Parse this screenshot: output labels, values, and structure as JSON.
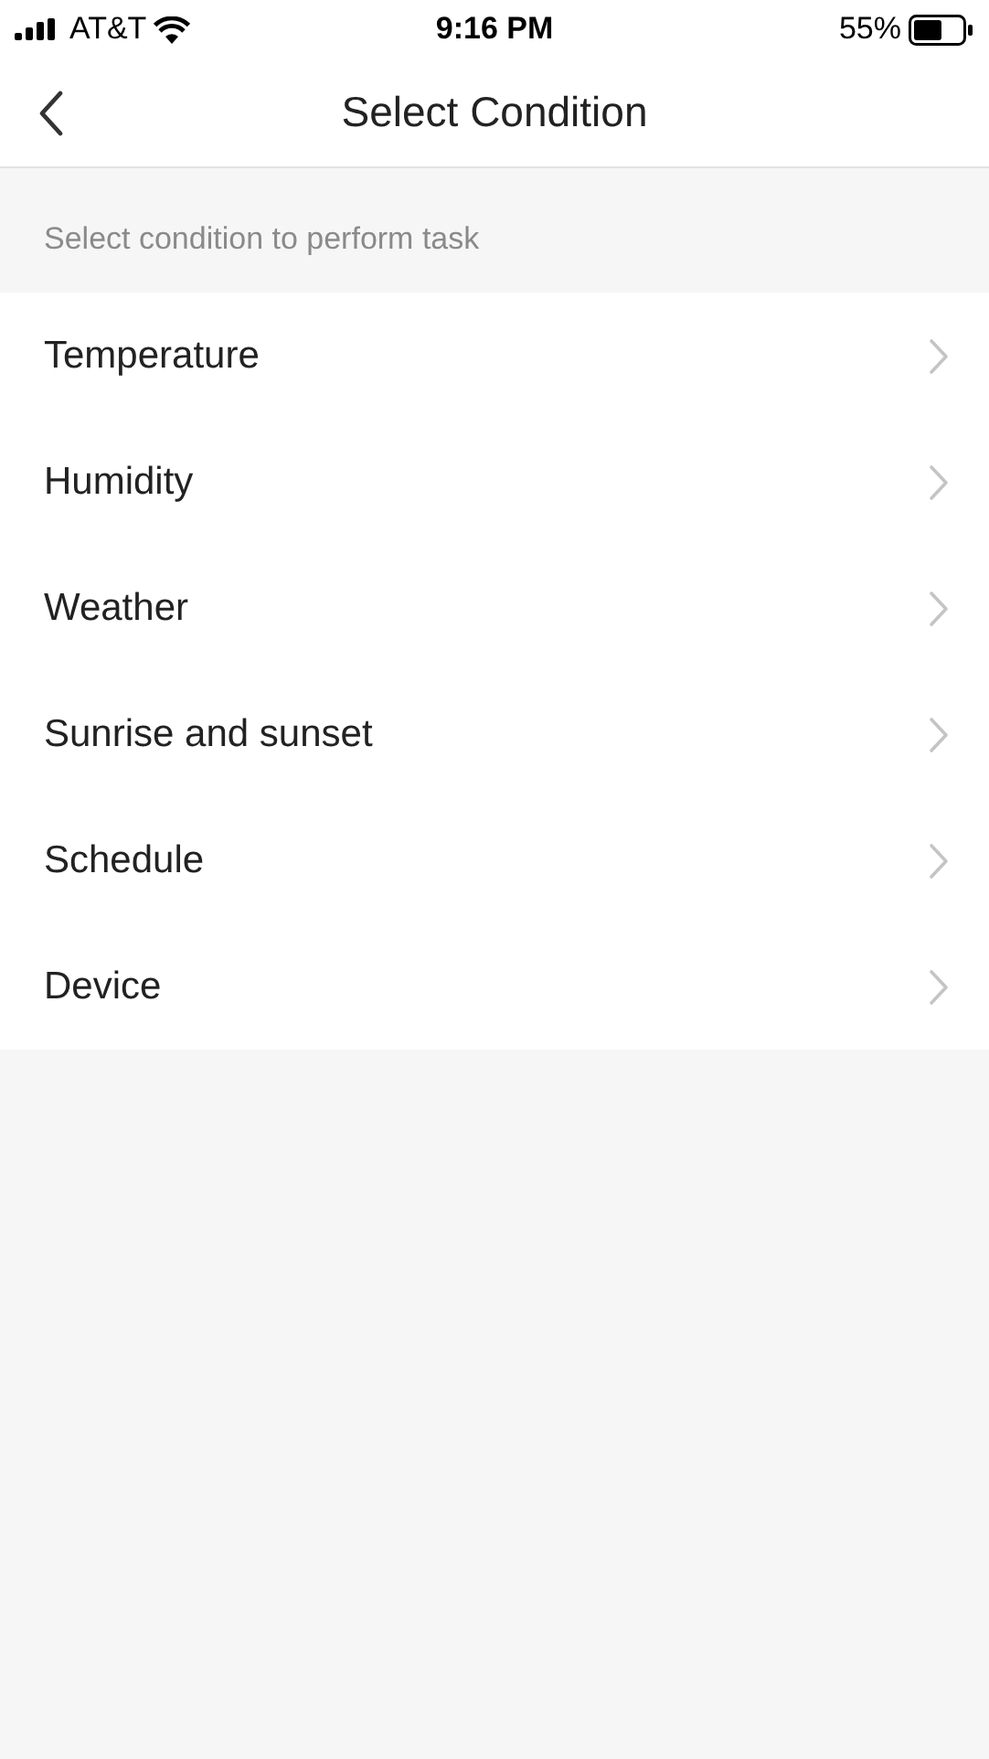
{
  "status_bar": {
    "carrier": "AT&T",
    "time": "9:16 PM",
    "battery": "55%"
  },
  "header": {
    "title": "Select Condition"
  },
  "hint": "Select condition to perform task",
  "items": [
    {
      "label": "Temperature"
    },
    {
      "label": "Humidity"
    },
    {
      "label": "Weather"
    },
    {
      "label": "Sunrise and sunset"
    },
    {
      "label": "Schedule"
    },
    {
      "label": "Device"
    }
  ]
}
